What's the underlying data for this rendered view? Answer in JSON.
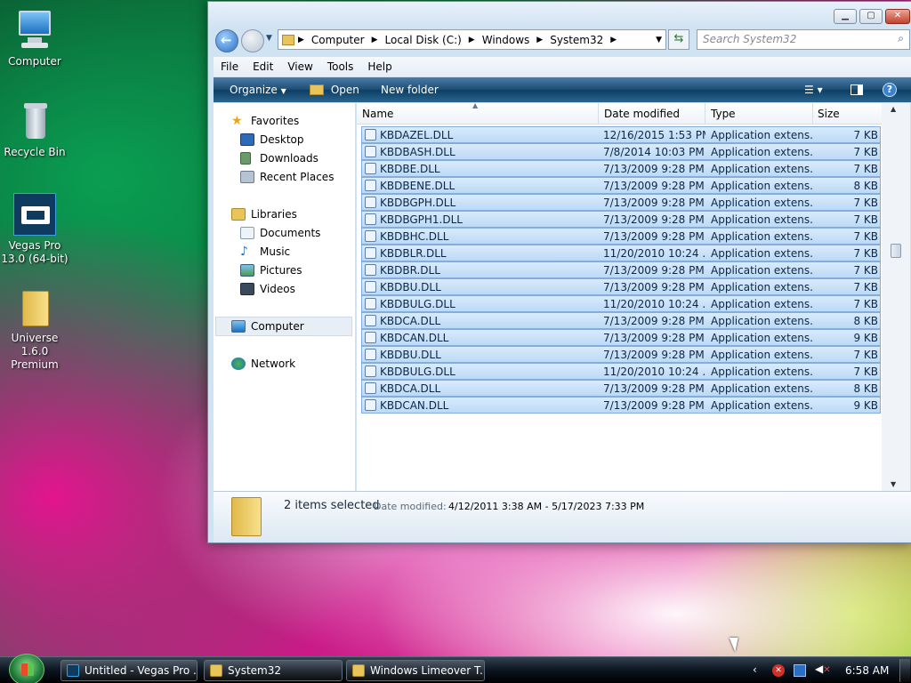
{
  "desktop": {
    "icons": [
      {
        "label": "Computer"
      },
      {
        "label": "Recycle Bin"
      },
      {
        "label": "Vegas Pro 13.0 (64-bit)"
      },
      {
        "label": "Universe 1.6.0 Premium"
      }
    ]
  },
  "window": {
    "address": {
      "segments": [
        "Computer",
        "Local Disk (C:)",
        "Windows",
        "System32"
      ]
    },
    "search": {
      "placeholder": "Search System32"
    },
    "menu": [
      "File",
      "Edit",
      "View",
      "Tools",
      "Help"
    ],
    "toolbar": {
      "organize": "Organize",
      "open": "Open",
      "new_folder": "New folder"
    },
    "nav": {
      "favorites": "Favorites",
      "desktop": "Desktop",
      "downloads": "Downloads",
      "recent": "Recent Places",
      "libraries": "Libraries",
      "documents": "Documents",
      "music": "Music",
      "pictures": "Pictures",
      "videos": "Videos",
      "computer": "Computer",
      "network": "Network"
    },
    "columns": {
      "name": "Name",
      "date": "Date modified",
      "type": "Type",
      "size": "Size"
    },
    "files": [
      {
        "name": "KBDAZEL.DLL",
        "date": "12/16/2015 1:53 PM",
        "type": "Application extens...",
        "size": "7 KB"
      },
      {
        "name": "KBDBASH.DLL",
        "date": "7/8/2014 10:03 PM",
        "type": "Application extens...",
        "size": "7 KB"
      },
      {
        "name": "KBDBE.DLL",
        "date": "7/13/2009 9:28 PM",
        "type": "Application extens...",
        "size": "7 KB"
      },
      {
        "name": "KBDBENE.DLL",
        "date": "7/13/2009 9:28 PM",
        "type": "Application extens...",
        "size": "8 KB"
      },
      {
        "name": "KBDBGPH.DLL",
        "date": "7/13/2009 9:28 PM",
        "type": "Application extens...",
        "size": "7 KB"
      },
      {
        "name": "KBDBGPH1.DLL",
        "date": "7/13/2009 9:28 PM",
        "type": "Application extens...",
        "size": "7 KB"
      },
      {
        "name": "KBDBHC.DLL",
        "date": "7/13/2009 9:28 PM",
        "type": "Application extens...",
        "size": "7 KB"
      },
      {
        "name": "KBDBLR.DLL",
        "date": "11/20/2010 10:24 ...",
        "type": "Application extens...",
        "size": "7 KB"
      },
      {
        "name": "KBDBR.DLL",
        "date": "7/13/2009 9:28 PM",
        "type": "Application extens...",
        "size": "7 KB"
      },
      {
        "name": "KBDBU.DLL",
        "date": "7/13/2009 9:28 PM",
        "type": "Application extens...",
        "size": "7 KB"
      },
      {
        "name": "KBDBULG.DLL",
        "date": "11/20/2010 10:24 ...",
        "type": "Application extens...",
        "size": "7 KB"
      },
      {
        "name": "KBDCA.DLL",
        "date": "7/13/2009 9:28 PM",
        "type": "Application extens...",
        "size": "8 KB"
      },
      {
        "name": "KBDCAN.DLL",
        "date": "7/13/2009 9:28 PM",
        "type": "Application extens...",
        "size": "9 KB"
      },
      {
        "name": "KBDBU.DLL",
        "date": "7/13/2009 9:28 PM",
        "type": "Application extens...",
        "size": "7 KB"
      },
      {
        "name": "KBDBULG.DLL",
        "date": "11/20/2010 10:24 ...",
        "type": "Application extens...",
        "size": "7 KB"
      },
      {
        "name": "KBDCA.DLL",
        "date": "7/13/2009 9:28 PM",
        "type": "Application extens...",
        "size": "8 KB"
      },
      {
        "name": "KBDCAN.DLL",
        "date": "7/13/2009 9:28 PM",
        "type": "Application extens...",
        "size": "9 KB"
      }
    ],
    "details": {
      "selected": "2 items selected",
      "date_label": "Date modified:",
      "date_range": "4/12/2011 3:38 AM - 5/17/2023 7:33 PM"
    }
  },
  "taskbar": {
    "items": [
      "Untitled - Vegas Pro ...",
      "System32",
      "Windows Limeover T..."
    ],
    "clock": "6:58 AM"
  }
}
